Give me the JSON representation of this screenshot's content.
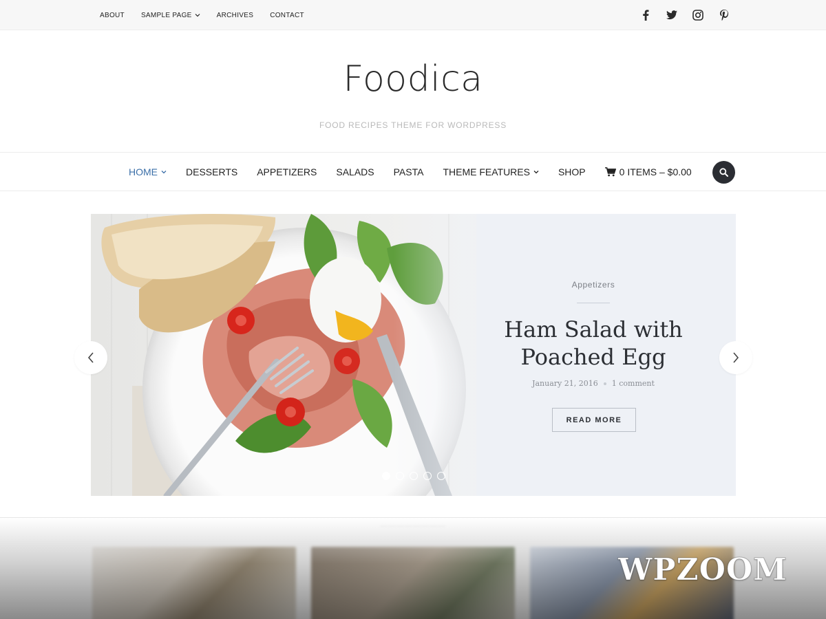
{
  "topbar": {
    "menu": [
      {
        "label": "ABOUT",
        "has_dropdown": false
      },
      {
        "label": "SAMPLE PAGE",
        "has_dropdown": true
      },
      {
        "label": "ARCHIVES",
        "has_dropdown": false
      },
      {
        "label": "CONTACT",
        "has_dropdown": false
      }
    ],
    "social_icons": [
      "facebook-icon",
      "twitter-icon",
      "instagram-icon",
      "pinterest-icon"
    ]
  },
  "header": {
    "logo": "Foodica",
    "tagline": "FOOD RECIPES THEME FOR WORDPRESS"
  },
  "nav": {
    "items": [
      {
        "label": "HOME",
        "active": true,
        "has_dropdown": true
      },
      {
        "label": "DESSERTS",
        "active": false,
        "has_dropdown": false
      },
      {
        "label": "APPETIZERS",
        "active": false,
        "has_dropdown": false
      },
      {
        "label": "SALADS",
        "active": false,
        "has_dropdown": false
      },
      {
        "label": "PASTA",
        "active": false,
        "has_dropdown": false
      },
      {
        "label": "THEME FEATURES",
        "active": false,
        "has_dropdown": true
      },
      {
        "label": "SHOP",
        "active": false,
        "has_dropdown": false
      }
    ],
    "cart_label": "0 ITEMS – $0.00",
    "cart_icon": "cart-icon",
    "search_icon": "search-icon",
    "active_color": "#3b6fa8"
  },
  "slide": {
    "category": "Appetizers",
    "title_line1": "Ham Salad with",
    "title_line2": "Poached Egg",
    "date": "January 21, 2016",
    "comments": "1 comment",
    "button": "READ MORE",
    "active_dot": 1,
    "dot_count": 5
  },
  "watermark": "WPZOOM"
}
